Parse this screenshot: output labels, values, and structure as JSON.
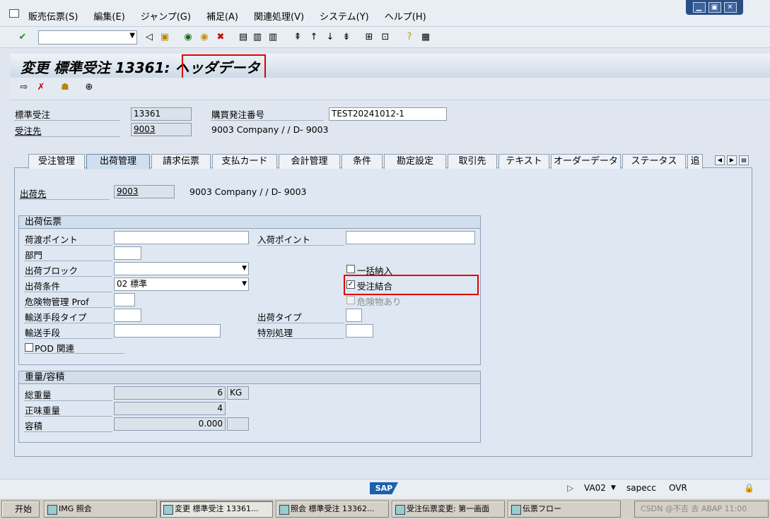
{
  "menubar": {
    "items": [
      "販売伝票(S)",
      "編集(E)",
      "ジャンプ(G)",
      "補足(A)",
      "関連処理(V)",
      "システム(Y)",
      "ヘルプ(H)"
    ]
  },
  "window_buttons": [
    "▁",
    "▣",
    "✕"
  ],
  "title": "変更 標準受注 13361: ヘッダデータ",
  "header": {
    "order_label": "標準受注",
    "order_value": "13361",
    "po_label": "購買発注番号",
    "po_value": "TEST20241012-1",
    "soldto_label": "受注先",
    "soldto_value": "9003",
    "soldto_desc": "9003 Company / / D- 9003"
  },
  "tabs": [
    "受注管理",
    "出荷管理",
    "請求伝票",
    "支払カード",
    "会計管理",
    "条件",
    "勘定設定",
    "取引先",
    "テキスト",
    "オーダーデータ",
    "ステータス",
    "追"
  ],
  "active_tab": "出荷管理",
  "shipto": {
    "label": "出荷先",
    "value": "9003",
    "desc": "9003 Company / / D- 9003"
  },
  "shipping_group": {
    "title": "出荷伝票",
    "shipping_point_label": "荷渡ポイント",
    "shipping_point_value": "",
    "receiving_point_label": "入荷ポイント",
    "receiving_point_value": "",
    "department_label": "部門",
    "department_value": "",
    "delivery_block_label": "出荷ブロック",
    "delivery_block_value": "",
    "complete_delivery_label": "一括納入",
    "shipping_cond_label": "出荷条件",
    "shipping_cond_value": "02 標準",
    "order_combination_label": "受注結合",
    "hazard_profile_label": "危険物管理 Prof",
    "hazard_label": "危険物あり",
    "transport_type_label": "輸送手段タイプ",
    "shipping_type_label": "出荷タイプ",
    "transport_label": "輸送手段",
    "special_processing_label": "特別処理",
    "pod_label": "POD 関連"
  },
  "weight_group": {
    "title": "重量/容積",
    "gross_label": "総重量",
    "gross_value": "6",
    "gross_unit": "KG",
    "net_label": "正味重量",
    "net_value": "4",
    "volume_label": "容積",
    "volume_value": "0.000",
    "volume_unit": ""
  },
  "statusbar": {
    "logo": "SAP",
    "tcode": "VA02",
    "server": "sapecc",
    "mode": "OVR"
  },
  "taskbar": {
    "start": "开始",
    "tasks": [
      "IMG 照会",
      "変更 標準受注 13361...",
      "照会 標準受注 13362...",
      "受注伝票変更: 第一画面",
      "伝票フロー"
    ],
    "tray": "CSDN @不吉 去 ABAP 11:00"
  }
}
